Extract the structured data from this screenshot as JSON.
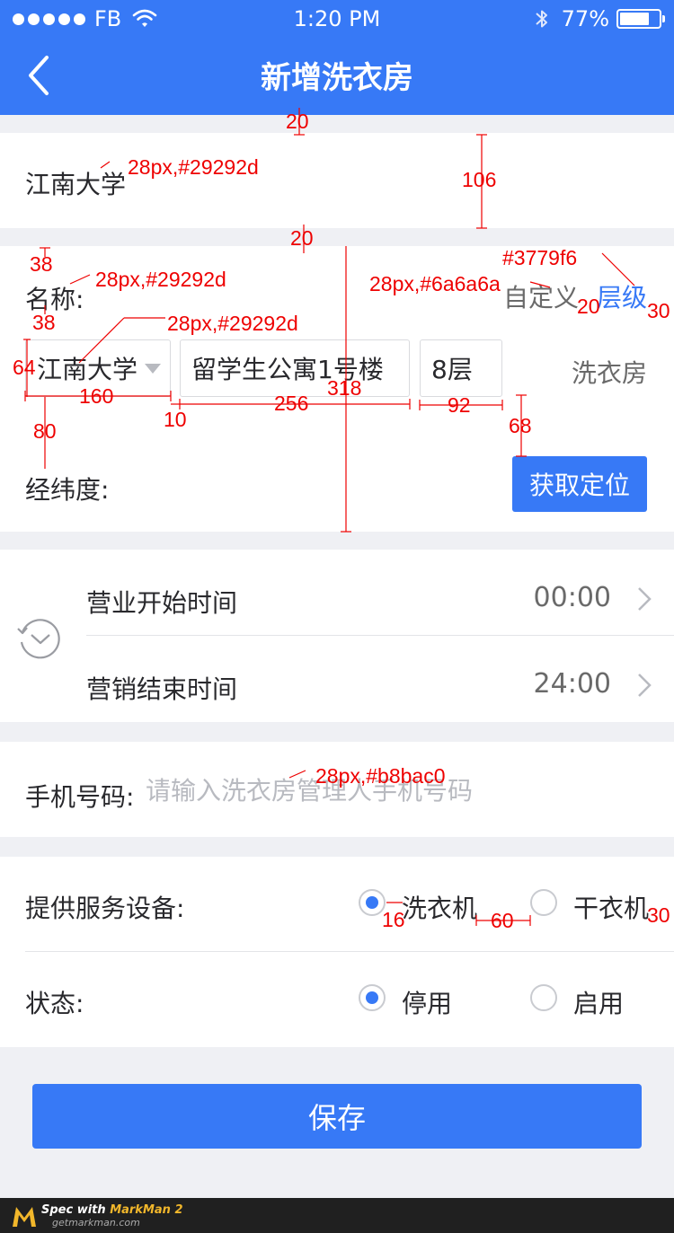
{
  "status_bar": {
    "carrier": "FB",
    "time": "1:20 PM",
    "battery_text": "77%",
    "battery_level": 0.77
  },
  "nav": {
    "title": "新增洗衣房",
    "back_icon": "chevron-left-icon"
  },
  "school_card": {
    "school": "江南大学"
  },
  "name_section": {
    "label": "名称:",
    "custom_label": "自定义",
    "level_label": "层级",
    "school_select": "江南大学",
    "building": "留学生公寓1号楼",
    "floor": "8层",
    "suffix": "洗衣房",
    "geo_label": "经纬度:",
    "locate_button": "获取定位"
  },
  "hours": {
    "icon": "clock-icon",
    "start_label": "营业开始时间",
    "start_value": "00:00",
    "end_label": "营销结束时间",
    "end_value": "24:00"
  },
  "phone": {
    "label": "手机号码:",
    "placeholder": "请输入洗衣房管理人手机号码",
    "value": ""
  },
  "devices": {
    "label": "提供服务设备:",
    "options": [
      "洗衣机",
      "干衣机"
    ],
    "selected": "洗衣机"
  },
  "status": {
    "label": "状态:",
    "options": [
      "停用",
      "启用"
    ],
    "selected": "停用"
  },
  "save_button": "保存",
  "footer": {
    "brand_prefix": "Spec with ",
    "brand_name": "MarkMan 2",
    "site": "getmarkman.com"
  },
  "annotations": {
    "a_gap1": "20",
    "a_school_font": "28px,#29292d",
    "a_card_h": "106",
    "a_gap2": "20",
    "a_top38": "38",
    "a_name_font": "28px,#29292d",
    "a_blue": "#3779f6",
    "a_custom_font": "28px,#6a6a6a",
    "a_gap20": "20",
    "a_right30": "30",
    "a_mid38": "38",
    "a_select_font": "28px,#29292d",
    "a_h64": "64",
    "a_w160": "160",
    "a_h318": "318",
    "a_g10": "10",
    "a_w256": "256",
    "a_w92": "92",
    "a_h68": "68",
    "a_h80": "80",
    "a_ph_font": "28px,#b8bac0",
    "a_r16": "16",
    "a_r60": "60",
    "a_r30": "30"
  },
  "colors": {
    "primary": "#3779f6",
    "text": "#29292d",
    "secondary": "#6a6a6a",
    "placeholder": "#b8bac0",
    "background": "#eff0f4",
    "annotation": "#e00000"
  }
}
